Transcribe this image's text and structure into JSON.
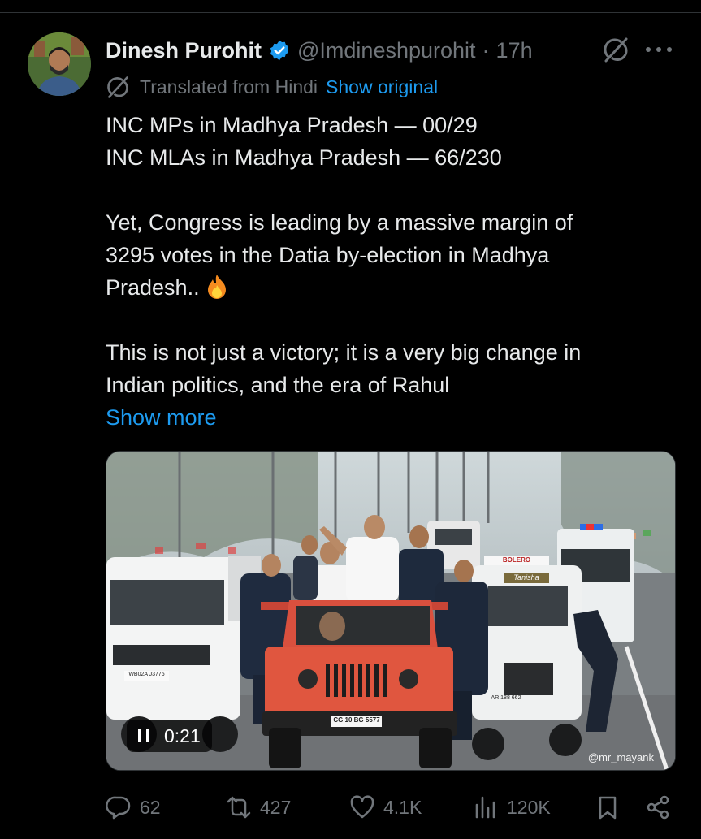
{
  "author": {
    "name": "Dinesh Purohit",
    "handle": "@Imdineshpurohit",
    "separator": "·",
    "time": "17h"
  },
  "translation": {
    "label": "Translated from Hindi",
    "link": "Show original"
  },
  "post": {
    "lines": [
      "INC MPs in Madhya Pradesh — 00/29",
      "INC MLAs in Madhya Pradesh — 66/230",
      "Yet, Congress is leading by a massive margin of",
      "3295 votes in the Datia by-election in Madhya",
      "Pradesh..",
      "This is not just a victory; it is a very big change in",
      "Indian politics, and the era of Rahul"
    ],
    "show_more": "Show more"
  },
  "media": {
    "duration": "0:21",
    "watermark": "@mr_mayank",
    "plate_front": "CG 10 BG 5577",
    "plate_left": "WB02A J3776",
    "plate_right": "AR 188 662",
    "van_label": "Tanisha",
    "van_sign": "BOLERO"
  },
  "stats": {
    "replies": "62",
    "reposts": "427",
    "likes": "4.1K",
    "views": "120K"
  },
  "icons": {
    "verified": "verified-badge-icon",
    "grok": "grok-icon",
    "more": "more-icon",
    "reply": "reply-icon",
    "repost": "repost-icon",
    "like": "like-icon",
    "views": "views-icon",
    "bookmark": "bookmark-icon",
    "share": "share-icon"
  },
  "colors": {
    "background": "#000000",
    "text": "#e7e9ea",
    "muted": "#71767b",
    "accent": "#1d9bf0"
  }
}
